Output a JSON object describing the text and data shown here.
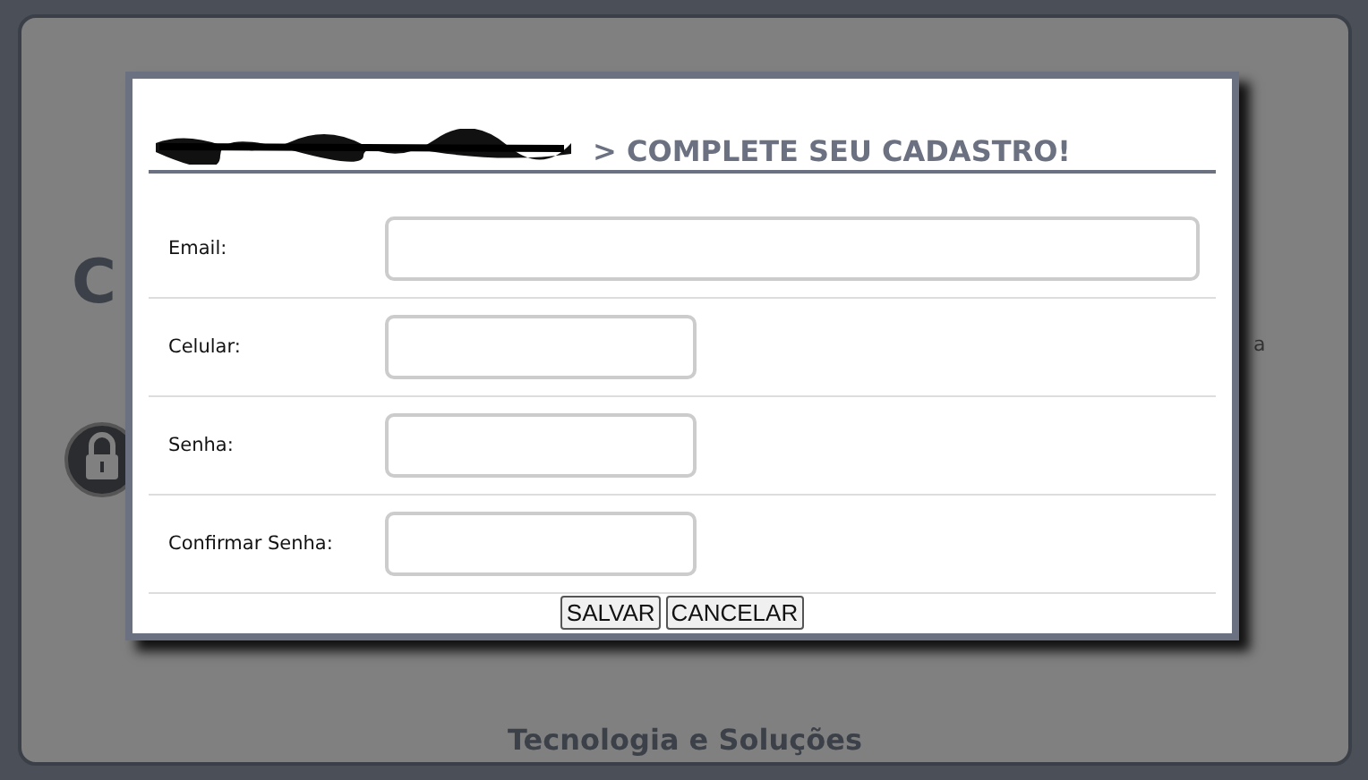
{
  "background": {
    "heading_fragment": "C",
    "text_fragment": "a",
    "footer": "Tecnologia e Soluções"
  },
  "dialog": {
    "title": "> COMPLETE SEU CADASTRO!",
    "fields": [
      {
        "label": "Email:",
        "kind": "wide"
      },
      {
        "label": "Celular:",
        "kind": "short"
      },
      {
        "label": "Senha:",
        "kind": "short"
      },
      {
        "label": "Confirmar Senha:",
        "kind": "short"
      }
    ],
    "buttons": [
      "SALVAR",
      "CANCELAR"
    ]
  }
}
